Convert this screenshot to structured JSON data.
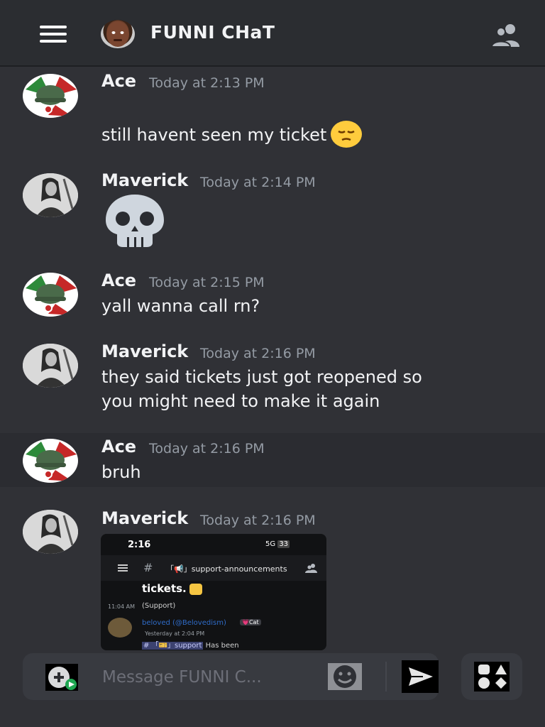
{
  "header": {
    "title": "FUNNI CHaT",
    "menu_icon": "hamburger-icon",
    "members_icon": "members-icon"
  },
  "messages": [
    {
      "author": "Ace",
      "timestamp": "Today at 2:13 PM",
      "text": "still havent seen my ticket",
      "emoji": "pensive-face"
    },
    {
      "author": "Maverick",
      "timestamp": "Today at 2:14 PM",
      "emoji": "skull"
    },
    {
      "author": "Ace",
      "timestamp": "Today at 2:15 PM",
      "text": "yall wanna call rn?"
    },
    {
      "author": "Maverick",
      "timestamp": "Today at 2:16 PM",
      "text_line1": "they said tickets just got reopened so",
      "text_line2": "you might need to make it again"
    },
    {
      "author": "Ace",
      "timestamp": "Today at 2:16 PM",
      "text": "bruh"
    },
    {
      "author": "Maverick",
      "timestamp": "Today at 2:16 PM",
      "attachment": "screenshot"
    }
  ],
  "embed": {
    "time": "2:16",
    "status": "5G",
    "battery": "33",
    "channel_hash": "#",
    "channel_name": "「📢」support-announcements",
    "headline": "tickets.",
    "msg_time": "11:04 AM",
    "msg_text": "(Support)",
    "reply_name": "beloved (@Belovedism)",
    "reply_badge": "💗Cat",
    "reply_time": "Yesterday at 2:04 PM",
    "reply_mention": "# 「🎫」support",
    "reply_text": "Has been"
  },
  "composer": {
    "placeholder": "Message FUNNI C..."
  },
  "colors": {
    "background": "#303136",
    "header": "#2b2d31",
    "timestamp": "#949ba4",
    "input": "#383a40"
  }
}
